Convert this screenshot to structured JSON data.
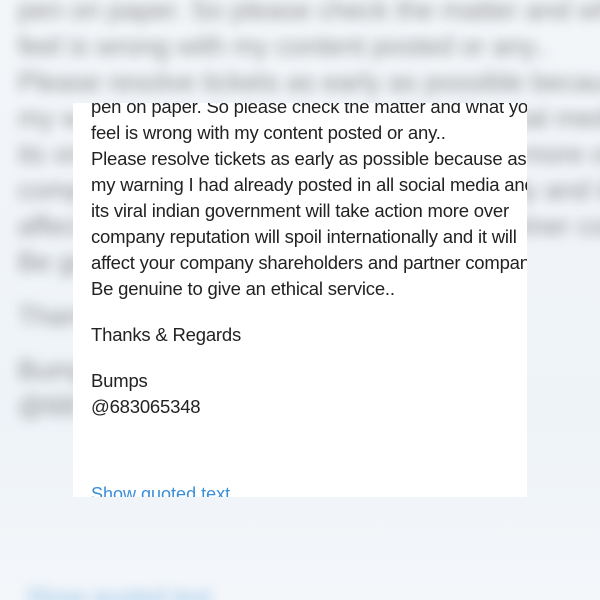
{
  "email": {
    "body_lines": [
      "pen on paper. So please check the matter and what you",
      "feel is wrong with my content posted or any..",
      "Please resolve tickets as early as possible because as of",
      "my warning I had already posted in all social media and if",
      "its viral indian government will take action more over",
      "company reputation will spoil internationally and it will",
      "affect your company shareholders and partner companies.",
      "Be genuine to give an ethical service.."
    ],
    "closing": "Thanks & Regards",
    "signature_name": "Bumps",
    "signature_handle": "@683065348",
    "show_quoted_label": "Show quoted text"
  }
}
